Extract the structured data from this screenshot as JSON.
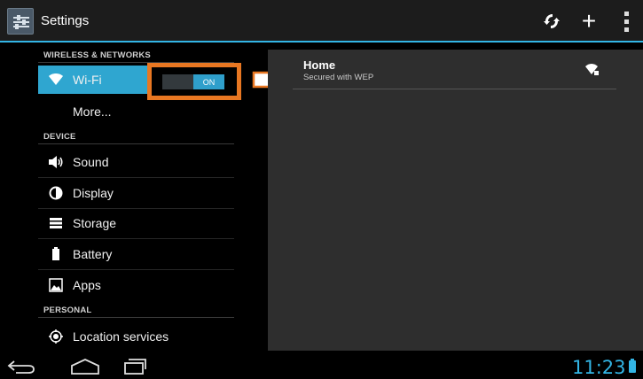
{
  "actionbar": {
    "title": "Settings",
    "app_icon": "settings-sliders-icon",
    "actions": [
      "sync-icon",
      "add-icon",
      "overflow-menu-icon"
    ],
    "add_label": "+"
  },
  "sidebar": {
    "sections": [
      {
        "header": "WIRELESS & NETWORKS"
      },
      {
        "header": "DEVICE"
      },
      {
        "header": "PERSONAL"
      }
    ],
    "items": [
      {
        "label": "Wi-Fi",
        "icon": "wifi-icon",
        "selected": true
      },
      {
        "label": "More...",
        "icon": ""
      },
      {
        "label": "Sound",
        "icon": "speaker-icon"
      },
      {
        "label": "Display",
        "icon": "brightness-icon"
      },
      {
        "label": "Storage",
        "icon": "storage-icon"
      },
      {
        "label": "Battery",
        "icon": "battery-icon"
      },
      {
        "label": "Apps",
        "icon": "apps-icon"
      },
      {
        "label": "Location services",
        "icon": "location-icon"
      }
    ],
    "wifi_toggle": {
      "state": "ON"
    }
  },
  "wifi_list": {
    "networks": [
      {
        "name": "Home",
        "security": "Secured with WEP",
        "icon": "wifi-locked-signal-icon"
      }
    ]
  },
  "navbar": {
    "buttons": [
      "back-icon",
      "home-icon",
      "recent-apps-icon"
    ],
    "clock": "11:23",
    "battery_icon": "battery-charging-icon"
  },
  "colors": {
    "accent": "#33b5e5",
    "selected_item": "#2fa6d0",
    "highlight_border": "#e87722",
    "panel": "#2e2e2e"
  }
}
